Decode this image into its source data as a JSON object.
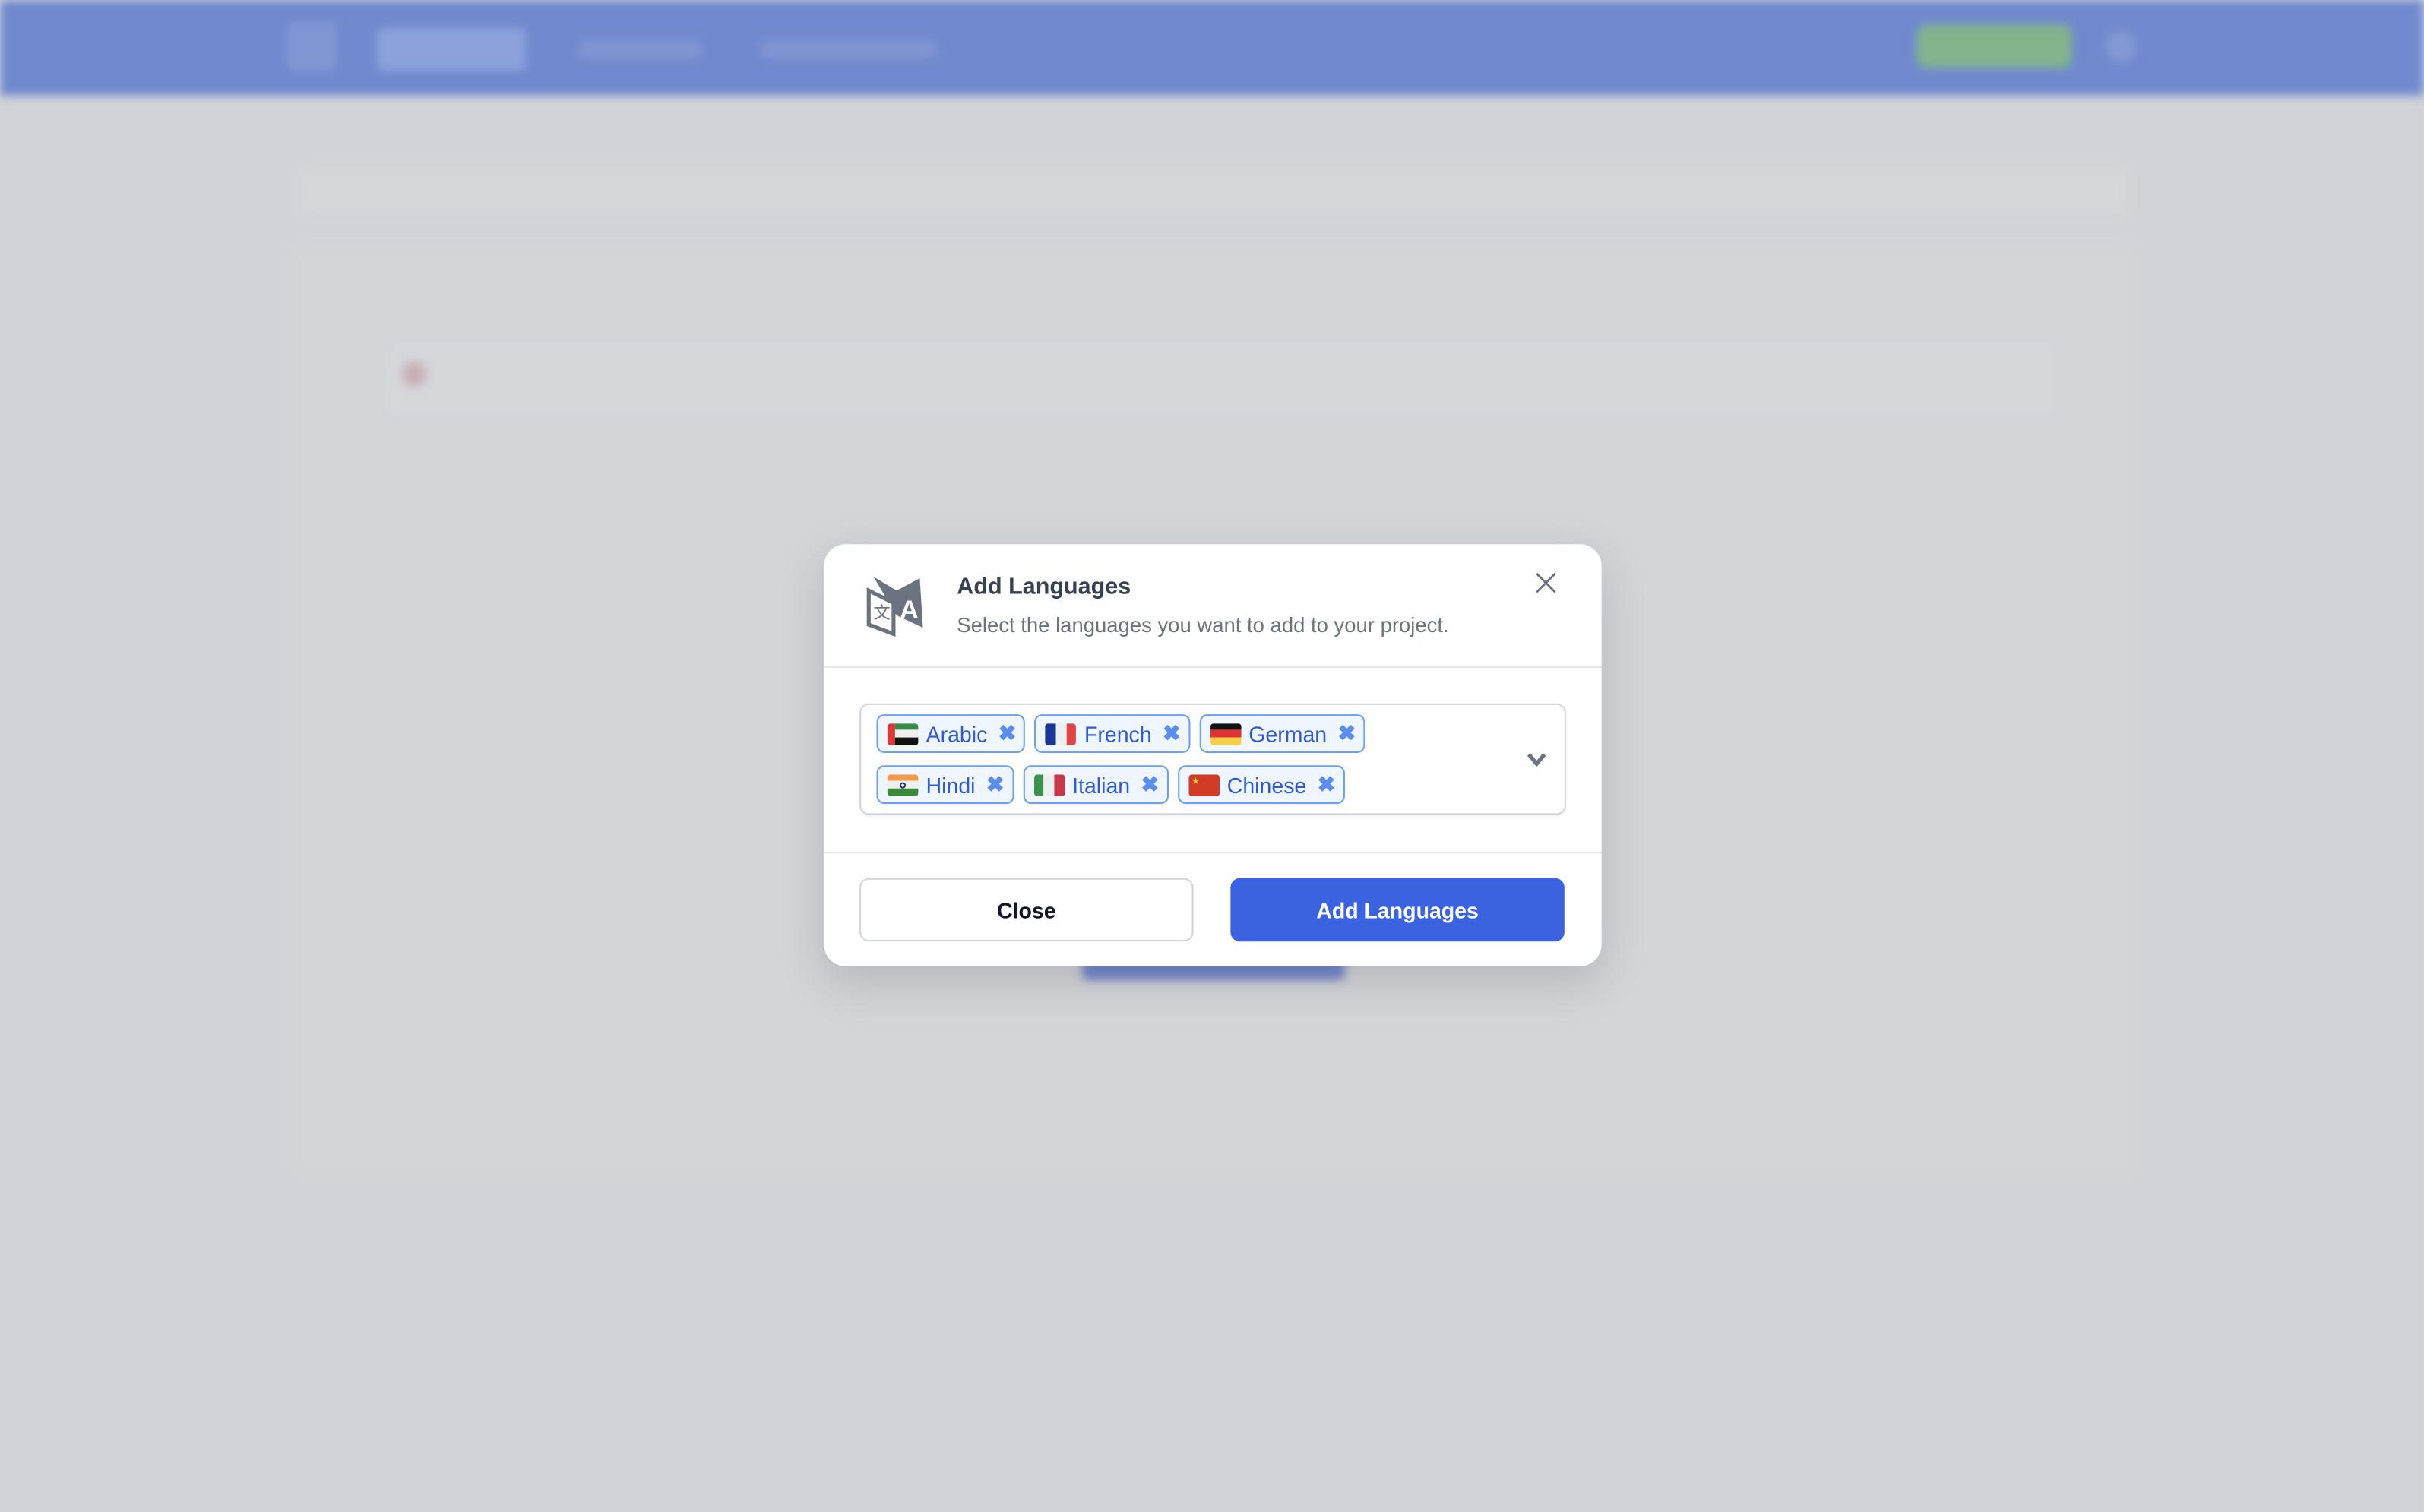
{
  "modal": {
    "title": "Add Languages",
    "subtitle": "Select the languages you want to add to your project.",
    "icon": "translate-icon",
    "selected_languages": [
      {
        "label": "Arabic",
        "flag": "uae"
      },
      {
        "label": "French",
        "flag": "france"
      },
      {
        "label": "German",
        "flag": "germany"
      },
      {
        "label": "Hindi",
        "flag": "india"
      },
      {
        "label": "Italian",
        "flag": "italy"
      },
      {
        "label": "Chinese",
        "flag": "china"
      }
    ],
    "remove_glyph": "✖",
    "close_label": "Close",
    "submit_label": "Add Languages"
  },
  "colors": {
    "primary": "#3b63e0",
    "topbar": "#4166cc",
    "chip_bg": "#eff6ff",
    "chip_text": "#2f5bd7"
  }
}
